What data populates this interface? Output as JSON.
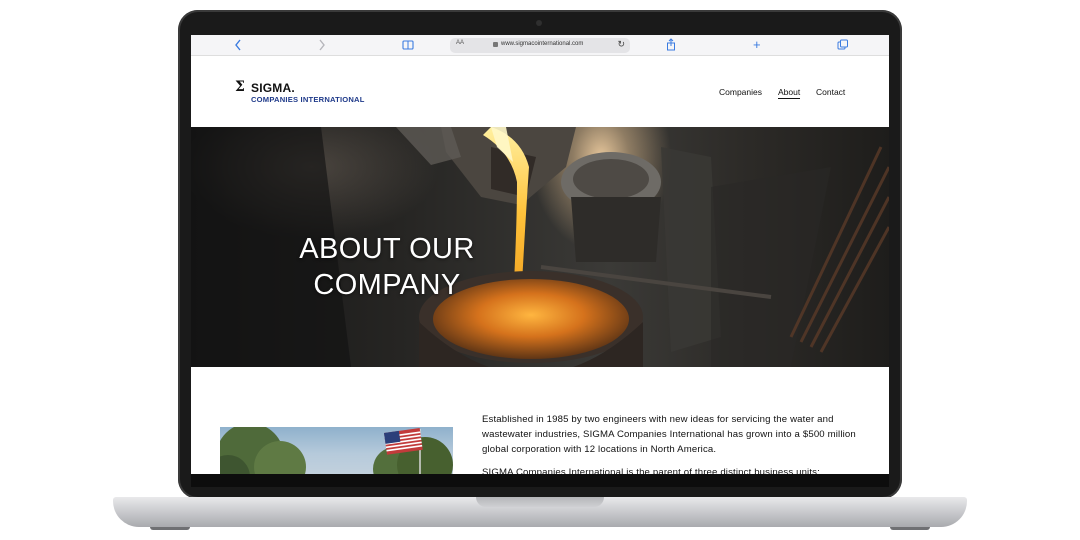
{
  "browser": {
    "url": "www.sigmacointernational.com",
    "text_size_label": "AA"
  },
  "site": {
    "logo_mark": "Σ",
    "logo_name": "SIGMA.",
    "logo_subtitle": "COMPANIES INTERNATIONAL",
    "nav": [
      {
        "label": "Companies",
        "active": false
      },
      {
        "label": "About",
        "active": true
      },
      {
        "label": "Contact",
        "active": false
      }
    ]
  },
  "hero": {
    "title_line1": "ABOUT OUR",
    "title_line2": "COMPANY"
  },
  "content": {
    "paragraph1": "Established in 1985 by two engineers with new ideas for servicing the water and wastewater industries, SIGMA Companies International has grown into a $500 million global corporation with 12 locations in North America.",
    "paragraph2": "SIGMA Companies International is the parent of three distinct business units:"
  },
  "icons": [
    "back-icon",
    "forward-icon",
    "reader-icon",
    "lock-icon",
    "reload-icon",
    "share-icon",
    "new-tab-icon",
    "tabs-icon"
  ],
  "colors": {
    "brand_blue": "#1f3a8a",
    "safari_blue": "#3a7be0",
    "molten_metal": "#f0a020"
  }
}
